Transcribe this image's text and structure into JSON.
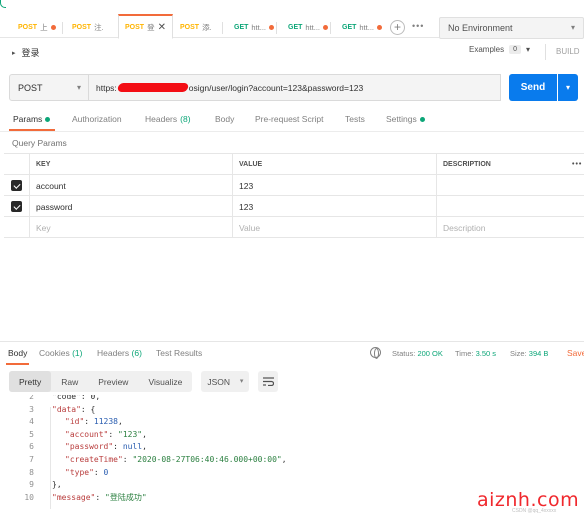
{
  "tabs": [
    {
      "method": "POST",
      "name": "上",
      "dot": true,
      "active": false
    },
    {
      "method": "POST",
      "name": "注.",
      "dot": false,
      "active": false
    },
    {
      "method": "POST",
      "name": "登",
      "dot": false,
      "active": true
    },
    {
      "method": "POST",
      "name": "添.",
      "dot": false,
      "active": false
    },
    {
      "method": "GET",
      "name": "htt...",
      "dot": true,
      "active": false
    },
    {
      "method": "GET",
      "name": "htt...",
      "dot": true,
      "active": false
    },
    {
      "method": "GET",
      "name": "htt...",
      "dot": true,
      "active": false
    }
  ],
  "tab_close": "✕",
  "new_tab": "+",
  "more_tabs": "•••",
  "environment": {
    "label": "No Environment",
    "caret": "▾"
  },
  "request": {
    "title": "登录",
    "caret": "▸",
    "examples_label": "Examples",
    "examples_count": "0",
    "examples_caret": "▾",
    "build_label": "BUILD",
    "method": "POST",
    "method_caret": "▾",
    "url_prefix": "https:",
    "url_suffix": "osign/user/login?account=123&password=123",
    "send_label": "Send",
    "send_caret": "▾"
  },
  "request_tabs": {
    "params": "Params",
    "authorization": "Authorization",
    "headers": "Headers",
    "headers_count": "(8)",
    "body": "Body",
    "prerequest": "Pre-request Script",
    "tests": "Tests",
    "settings": "Settings"
  },
  "query_params_title": "Query Params",
  "params_table": {
    "headers": {
      "key": "KEY",
      "value": "VALUE",
      "description": "DESCRIPTION",
      "more": "•••"
    },
    "rows": [
      {
        "key": "account",
        "value": "123",
        "description": ""
      },
      {
        "key": "password",
        "value": "123",
        "description": ""
      }
    ],
    "placeholder": {
      "key": "Key",
      "value": "Value",
      "description": "Description"
    }
  },
  "response": {
    "tabs": {
      "body": "Body",
      "cookies": "Cookies",
      "cookies_count": "(1)",
      "headers": "Headers",
      "headers_count": "(6)",
      "test_results": "Test Results"
    },
    "status_label": "Status:",
    "status_value": "200 OK",
    "time_label": "Time:",
    "time_value": "3.50 s",
    "size_label": "Size:",
    "size_value": "394 B",
    "save_label": "Save",
    "view_modes": [
      "Pretty",
      "Raw",
      "Preview",
      "Visualize"
    ],
    "active_view": "Pretty",
    "format": "JSON",
    "format_caret": "▾"
  },
  "code_lines": [
    {
      "num": "2",
      "indent": 1,
      "parts": [
        {
          "t": "p",
          "v": "\"code\": 0,"
        }
      ]
    },
    {
      "num": "3",
      "indent": 1,
      "parts": [
        {
          "t": "k",
          "v": "\"data\""
        },
        {
          "t": "p",
          "v": ": {"
        }
      ]
    },
    {
      "num": "4",
      "indent": 2,
      "parts": [
        {
          "t": "k",
          "v": "\"id\""
        },
        {
          "t": "p",
          "v": ": "
        },
        {
          "t": "n",
          "v": "11238"
        },
        {
          "t": "p",
          "v": ","
        }
      ]
    },
    {
      "num": "5",
      "indent": 2,
      "parts": [
        {
          "t": "k",
          "v": "\"account\""
        },
        {
          "t": "p",
          "v": ": "
        },
        {
          "t": "s",
          "v": "\"123\""
        },
        {
          "t": "p",
          "v": ","
        }
      ]
    },
    {
      "num": "6",
      "indent": 2,
      "parts": [
        {
          "t": "k",
          "v": "\"password\""
        },
        {
          "t": "p",
          "v": ": "
        },
        {
          "t": "n",
          "v": "null"
        },
        {
          "t": "p",
          "v": ","
        }
      ]
    },
    {
      "num": "7",
      "indent": 2,
      "parts": [
        {
          "t": "k",
          "v": "\"createTime\""
        },
        {
          "t": "p",
          "v": ": "
        },
        {
          "t": "s",
          "v": "\"2020-08-27T06:40:46.000+00:00\""
        },
        {
          "t": "p",
          "v": ","
        }
      ]
    },
    {
      "num": "8",
      "indent": 2,
      "parts": [
        {
          "t": "k",
          "v": "\"type\""
        },
        {
          "t": "p",
          "v": ": "
        },
        {
          "t": "n",
          "v": "0"
        }
      ]
    },
    {
      "num": "9",
      "indent": 1,
      "parts": [
        {
          "t": "p",
          "v": "},"
        }
      ]
    },
    {
      "num": "10",
      "indent": 1,
      "parts": [
        {
          "t": "k",
          "v": "\"message\""
        },
        {
          "t": "p",
          "v": ": "
        },
        {
          "t": "s",
          "v": "\"登陆成功\""
        }
      ]
    }
  ],
  "watermark": "aiznh.com",
  "watermark_sub": "CSDN @qq_4xxxxx"
}
